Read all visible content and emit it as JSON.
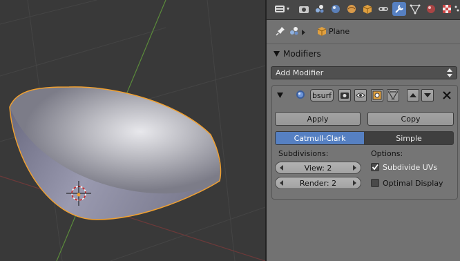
{
  "context": {
    "object_name": "Plane"
  },
  "modifiers": {
    "section_title": "Modifiers",
    "add_modifier_label": "Add Modifier",
    "modifier_name": "bsurf",
    "apply_label": "Apply",
    "copy_label": "Copy",
    "mode_tabs": [
      {
        "label": "Catmull-Clark",
        "active": true
      },
      {
        "label": "Simple",
        "active": false
      }
    ],
    "subdivisions_label": "Subdivisions:",
    "view_field": "View: 2",
    "render_field": "Render: 2",
    "options_label": "Options:",
    "subdivide_uvs_label": "Subdivide UVs",
    "subdivide_uvs_checked": true,
    "optimal_display_label": "Optimal Display",
    "optimal_display_checked": false
  },
  "toolbar_icons": [
    "editor-type-icon",
    "render-icon",
    "render-layers-icon",
    "scene-icon",
    "world-icon",
    "object-icon",
    "constraints-icon",
    "modifiers-icon",
    "data-icon",
    "material-icon",
    "texture-icon",
    "particles-icon",
    "physics-icon"
  ],
  "colors": {
    "accent": "#5680c2",
    "selection_outline": "#f0a030",
    "panel_bg": "#727272"
  }
}
